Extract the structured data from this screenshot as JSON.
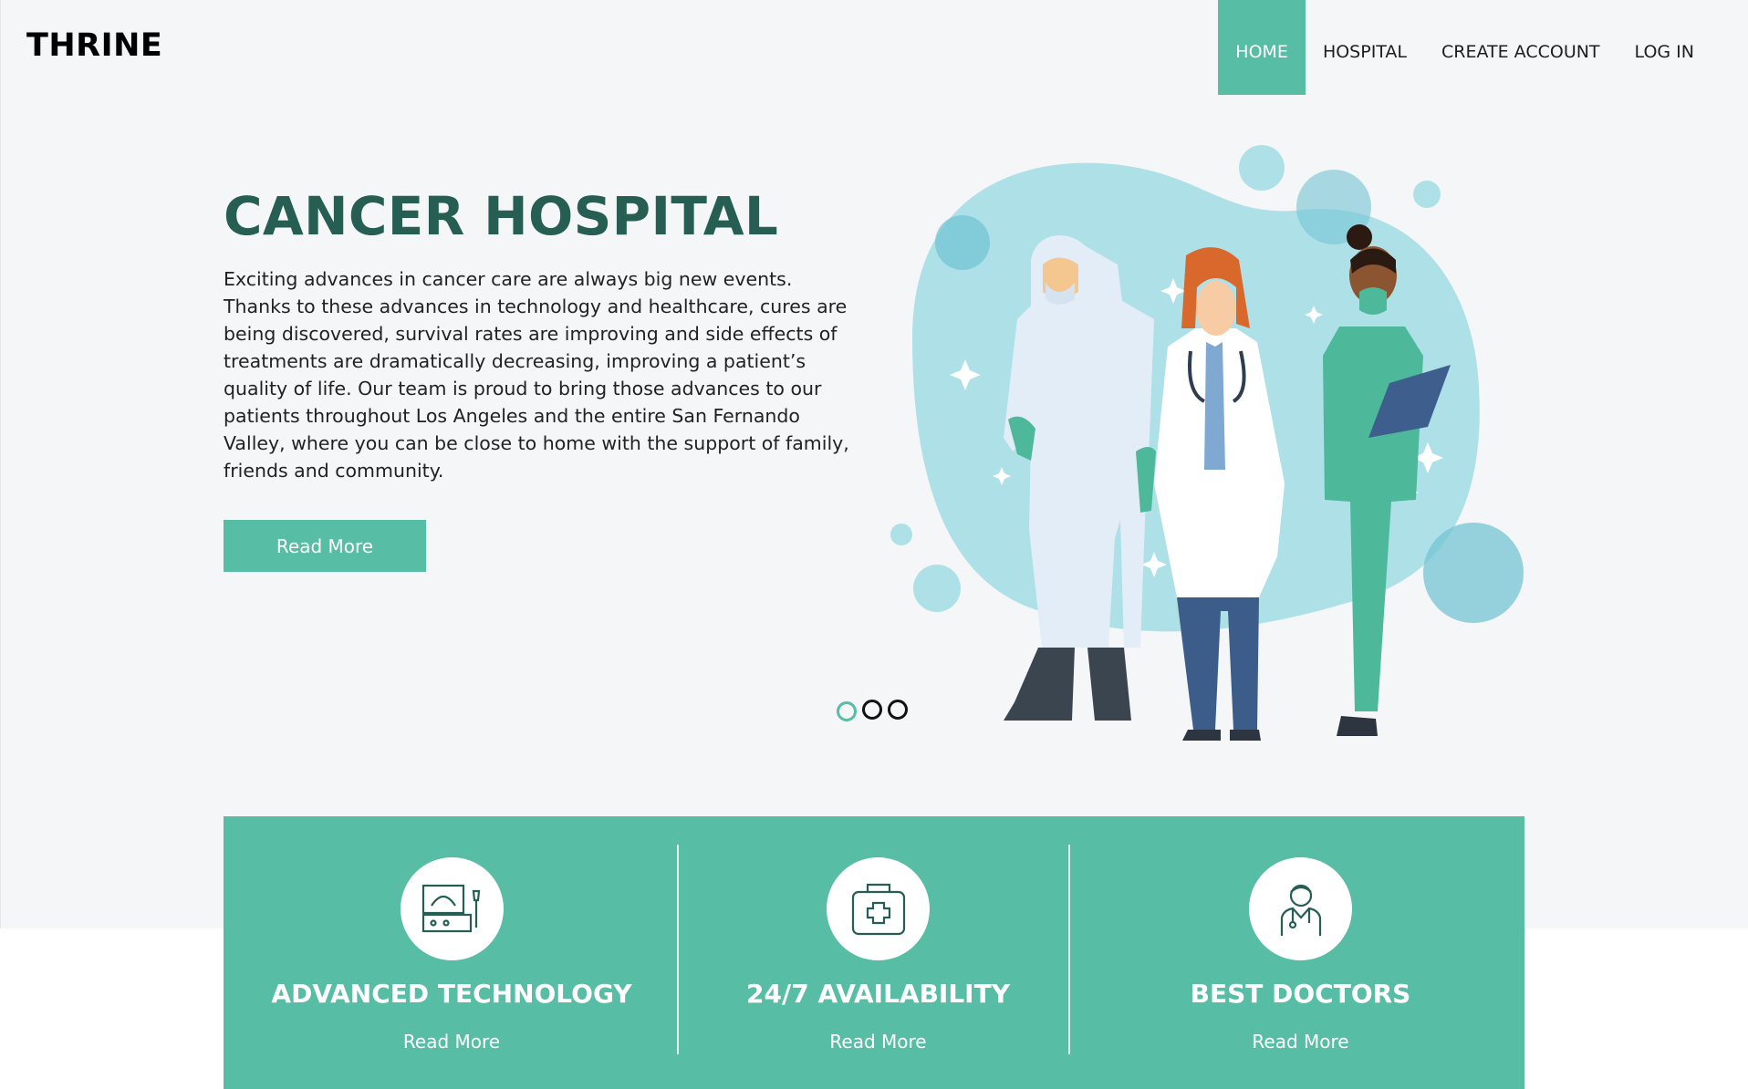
{
  "brand": {
    "logo": "THRINE"
  },
  "nav": {
    "items": [
      {
        "label": "HOME",
        "active": true
      },
      {
        "label": "HOSPITAL",
        "active": false
      },
      {
        "label": "CREATE ACCOUNT",
        "active": false
      },
      {
        "label": "LOG IN",
        "active": false
      }
    ]
  },
  "hero": {
    "title": "CANCER HOSPITAL",
    "text": "Exciting advances in cancer care are always big new events. Thanks to these advances in technology and healthcare, cures are being discovered, survival rates are improving and side effects of treatments are dramatically decreasing, improving a patient’s quality of life. Our team is proud to bring those advances to our patients throughout Los Angeles and the entire San Fernando Valley, where you can be close to home with the support of family, friends and community.",
    "button_label": "Read More",
    "carousel": {
      "slides": 3,
      "active_index": 0
    }
  },
  "features": [
    {
      "title": "ADVANCED TECHNOLOGY",
      "link": "Read More",
      "icon": "ultrasound-machine-icon"
    },
    {
      "title": "24/7 AVAILABILITY",
      "link": "Read More",
      "icon": "first-aid-kit-icon"
    },
    {
      "title": "BEST DOCTORS",
      "link": "Read More",
      "icon": "doctor-icon"
    }
  ],
  "colors": {
    "accent": "#57bda4",
    "title": "#265e53",
    "hero_background": "#f5f6f8",
    "blob": "#aee0e8"
  }
}
